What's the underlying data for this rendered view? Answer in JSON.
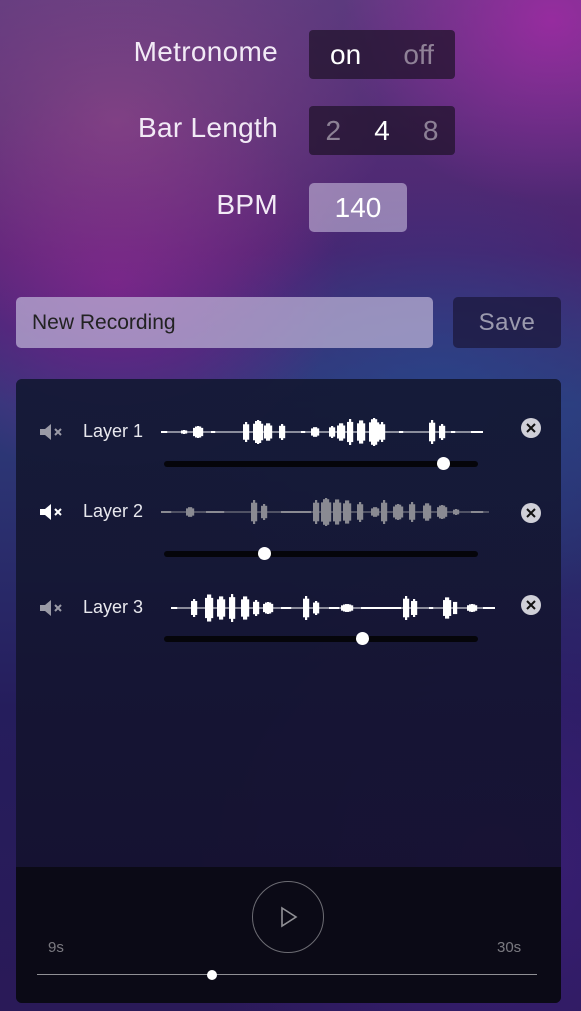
{
  "metronome": {
    "label": "Metronome",
    "options": [
      "on",
      "off"
    ],
    "selected": "on"
  },
  "bar_length": {
    "label": "Bar Length",
    "options": [
      "2",
      "4",
      "8"
    ],
    "selected": "4"
  },
  "bpm": {
    "label": "BPM",
    "value": "140"
  },
  "recording": {
    "name_value": "New Recording",
    "save_label": "Save"
  },
  "layers": [
    {
      "name": "Layer 1",
      "muted": false,
      "volume": 0.89,
      "waveform_color": "#ffffff",
      "icon": "speaker-muted-icon"
    },
    {
      "name": "Layer 2",
      "muted": true,
      "volume": 0.32,
      "waveform_color": "#8a8a92",
      "icon": "speaker-muted-icon"
    },
    {
      "name": "Layer 3",
      "muted": false,
      "volume": 0.63,
      "waveform_color": "#ffffff",
      "icon": "speaker-muted-icon"
    }
  ],
  "transport": {
    "play_icon": "play-icon",
    "start_time": "9s",
    "end_time": "30s",
    "progress": 0.35
  },
  "colors": {
    "active_text": "#ffffff",
    "inactive_text": "rgba(255,255,255,0.45)",
    "panel": "#10102a",
    "transport": "#0b0a16"
  }
}
